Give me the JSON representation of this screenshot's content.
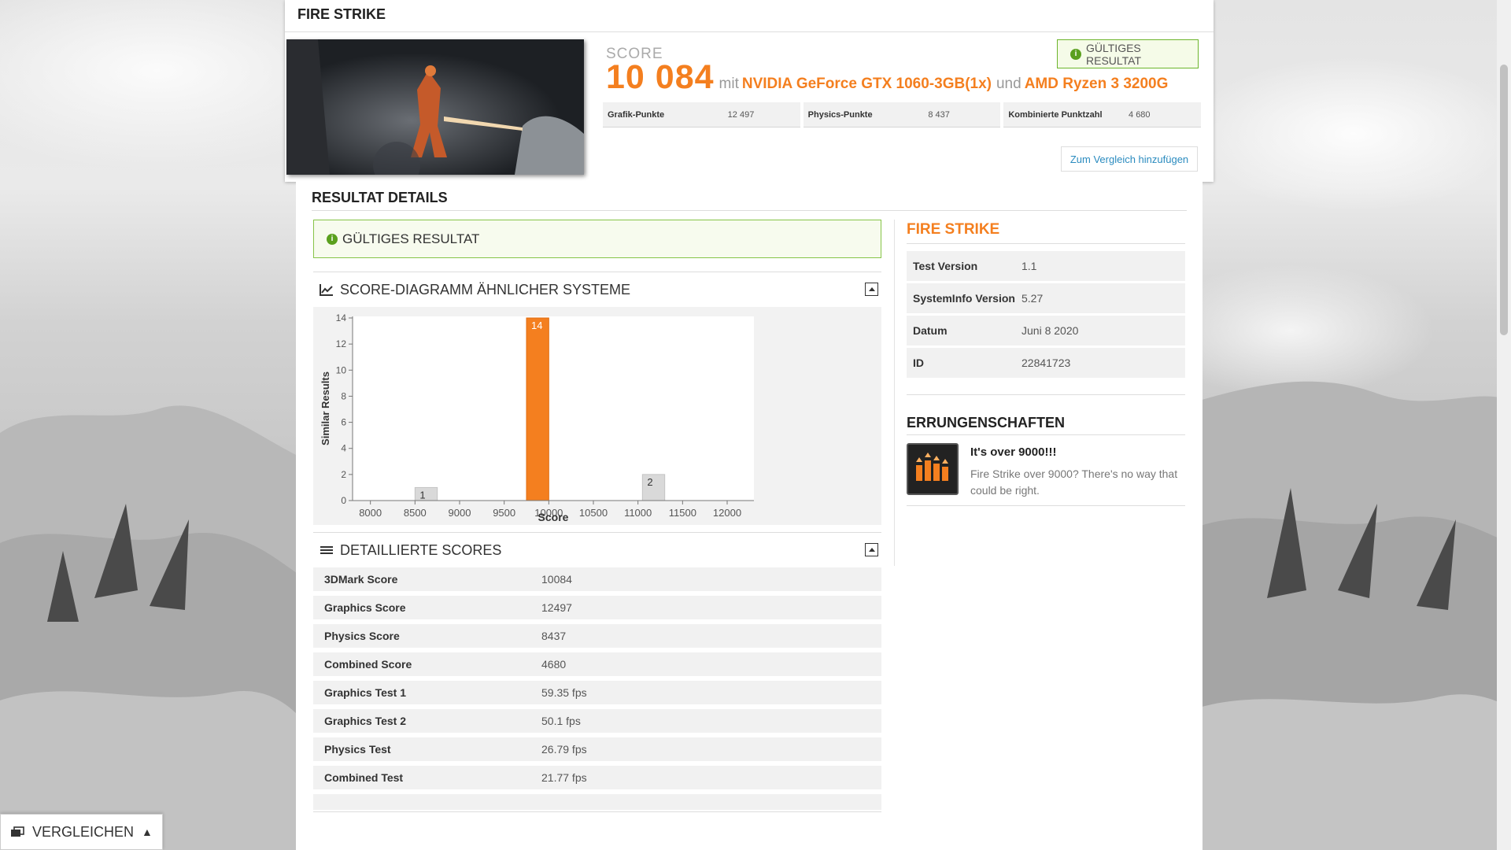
{
  "top": {
    "title": "FIRE STRIKE",
    "score_label": "SCORE",
    "score_value": "10 084",
    "connector_mit": "mit",
    "gpu": "NVIDIA GeForce GTX 1060-3GB(1x)",
    "connector_und": "und",
    "cpu": "AMD Ryzen 3 3200G",
    "valid_badge": "GÜLTIGES RESULTAT",
    "subscores": [
      {
        "label": "Grafik-Punkte",
        "value": "12 497"
      },
      {
        "label": "Physics-Punkte",
        "value": "8 437"
      },
      {
        "label": "Kombinierte Punktzahl",
        "value": "4 680"
      }
    ],
    "compare_button": "Zum Vergleich hinzufügen"
  },
  "details": {
    "title": "RESULTAT DETAILS",
    "valid_box": "GÜLTIGES RESULTAT",
    "diagram_title": "SCORE-DIAGRAMM ÄHNLICHER SYSTEME",
    "scores_title": "DETAILLIERTE SCORES",
    "scores": [
      {
        "label": "3DMark Score",
        "value": "10084"
      },
      {
        "label": "Graphics Score",
        "value": "12497"
      },
      {
        "label": "Physics Score",
        "value": "8437"
      },
      {
        "label": "Combined Score",
        "value": "4680"
      },
      {
        "label": "Graphics Test 1",
        "value": "59.35 fps"
      },
      {
        "label": "Graphics Test 2",
        "value": "50.1 fps"
      },
      {
        "label": "Physics Test",
        "value": "26.79 fps"
      },
      {
        "label": "Combined Test",
        "value": "21.77 fps"
      }
    ]
  },
  "side": {
    "title": "FIRE STRIKE",
    "info": [
      {
        "label": "Test Version",
        "value": "1.1"
      },
      {
        "label": "SystemInfo Version",
        "value": "5.27"
      },
      {
        "label": "Datum",
        "value": "Juni 8 2020"
      },
      {
        "label": "ID",
        "value": "22841723"
      }
    ],
    "achievements_title": "ERRUNGENSCHAFTEN",
    "achievement": {
      "name": "It's over 9000!!!",
      "description": "Fire Strike over 9000? There's no way that could be right."
    }
  },
  "compare_bar": {
    "label": "VERGLEICHEN"
  },
  "colors": {
    "accent": "#f47f1f",
    "valid_green": "#6cb52c",
    "link": "#2a8bbf"
  },
  "chart_data": {
    "type": "bar",
    "xlabel": "Score",
    "ylabel": "Similar Results",
    "xlim": [
      7800,
      12300
    ],
    "ylim": [
      0,
      14
    ],
    "x_ticks": [
      8000,
      8500,
      9000,
      9500,
      10000,
      10500,
      11000,
      11500,
      12000
    ],
    "y_ticks": [
      0,
      2,
      4,
      6,
      8,
      10,
      12,
      14
    ],
    "bins": [
      {
        "start": 8500,
        "end": 8750,
        "value": 1,
        "highlight": false
      },
      {
        "start": 9750,
        "end": 10000,
        "value": 14,
        "highlight": true
      },
      {
        "start": 11050,
        "end": 11300,
        "value": 2,
        "highlight": false
      }
    ]
  }
}
